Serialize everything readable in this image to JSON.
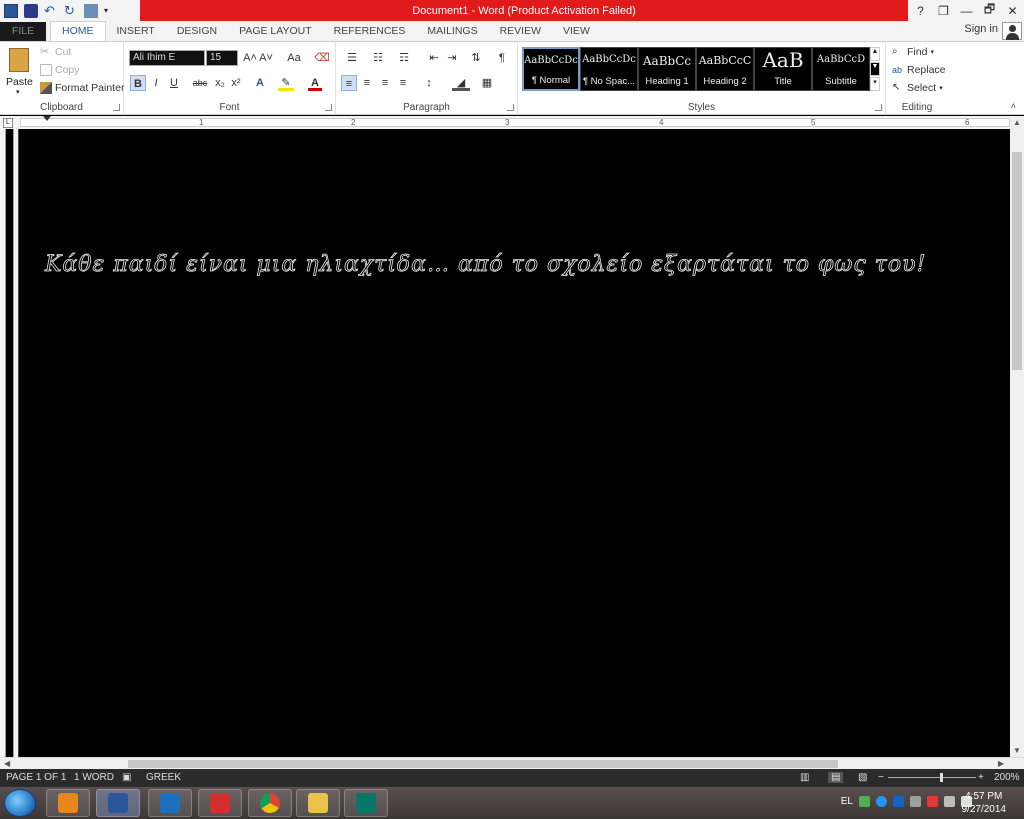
{
  "window": {
    "title": "Document1 - Word (Product Activation Failed)",
    "controls": [
      "?",
      "❐",
      "—",
      "🗗",
      "✕"
    ]
  },
  "tabs": [
    "FILE",
    "HOME",
    "INSERT",
    "DESIGN",
    "PAGE LAYOUT",
    "REFERENCES",
    "MAILINGS",
    "REVIEW",
    "VIEW"
  ],
  "active_tab": "HOME",
  "signin": "Sign in",
  "ribbon": {
    "clipboard": {
      "label": "Clipboard",
      "paste": "Paste",
      "cut": "Cut",
      "copy": "Copy",
      "format_painter": "Format Painter"
    },
    "font": {
      "label": "Font",
      "name": "Ali Ihim E",
      "size": "15",
      "bold": "B",
      "italic": "I",
      "underline": "U",
      "strike": "abc",
      "sub": "x₂",
      "sup": "x²",
      "grow": "A˄",
      "shrink": "A˅",
      "case": "Aa",
      "clear": "⌫"
    },
    "paragraph": {
      "label": "Paragraph",
      "pilcrow": "¶"
    },
    "styles": {
      "label": "Styles",
      "items": [
        {
          "sample": "AaBbCcDc",
          "name": "¶ Normal"
        },
        {
          "sample": "AaBbCcDc",
          "name": "¶ No Spac..."
        },
        {
          "sample": "AaBbCc",
          "name": "Heading 1"
        },
        {
          "sample": "AaBbCcC",
          "name": "Heading 2"
        },
        {
          "sample": "AaB",
          "name": "Title"
        },
        {
          "sample": "AaBbCcD",
          "name": "Subtitle"
        }
      ]
    },
    "editing": {
      "label": "Editing",
      "find": "Find",
      "replace": "Replace",
      "select": "Select"
    }
  },
  "ruler": {
    "numbers": [
      "1",
      "2",
      "3",
      "4",
      "5",
      "6"
    ]
  },
  "document": {
    "text": "Κάθε παιδί είναι μια ηλιαχτίδα… από το σχολείο εξαρτάται το φως του!"
  },
  "status": {
    "page": "PAGE 1 OF 1",
    "words": "1 WORD",
    "language": "GREEK",
    "zoom": "200%"
  },
  "taskbar": {
    "time": "4:57 PM",
    "date": "9/27/2014",
    "lang": "EL"
  },
  "colors": {
    "title_bar": "#e11b1b",
    "accent": "#2b579a",
    "document_bg": "#000000"
  }
}
